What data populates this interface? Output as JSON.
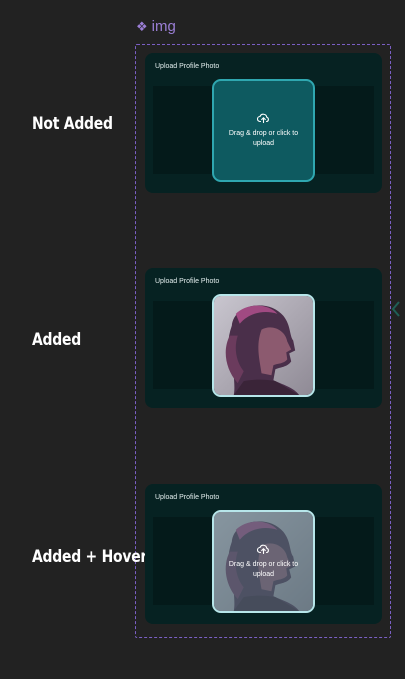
{
  "component_tag": {
    "icon": "diamond-icon",
    "label": "img"
  },
  "states": [
    {
      "label": "Not Added",
      "card_title": "Upload Profile Photo",
      "variant": "empty",
      "upload_text": "Drag & drop or click to upload"
    },
    {
      "label": "Added",
      "card_title": "Upload Profile Photo",
      "variant": "photo"
    },
    {
      "label": "Added + Hover",
      "card_title": "Upload Profile Photo",
      "variant": "photo-hover",
      "upload_text": "Drag & drop or click to upload"
    }
  ],
  "colors": {
    "background": "#222222",
    "card": "#062222",
    "upload_empty": "#0e5a60",
    "upload_border": "#2fa7b0",
    "frame_border": "#7b5fc4"
  }
}
